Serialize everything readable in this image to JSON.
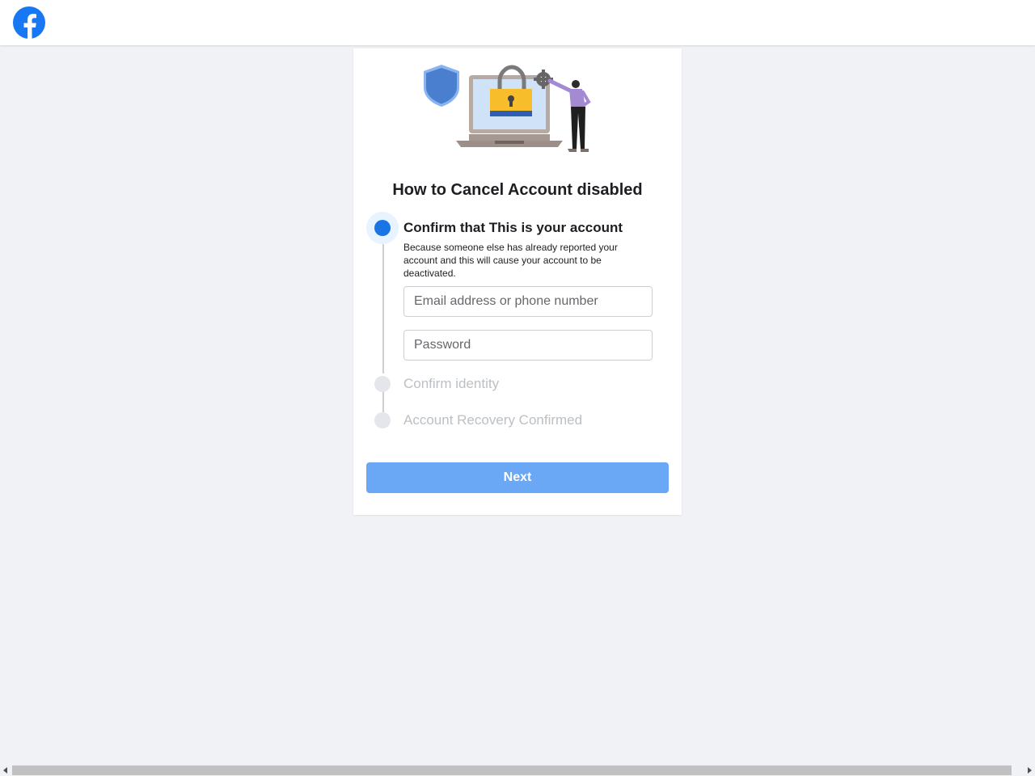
{
  "header": {
    "logo_icon": "facebook-logo-icon",
    "brand_color": "#1877f2"
  },
  "illustration": {
    "icons": [
      "shield-icon",
      "laptop-icon",
      "padlock-icon",
      "gear-icon",
      "person-icon"
    ]
  },
  "card": {
    "title": "How to Cancel Account disabled",
    "steps": [
      {
        "title": "Confirm that This is your account",
        "description": "Because someone else has already reported your account and this will cause your account to be deactivated.",
        "state": "active"
      },
      {
        "title": "Confirm identity",
        "state": "inactive"
      },
      {
        "title": "Account Recovery Confirmed",
        "state": "inactive"
      }
    ],
    "email_placeholder": "Email address or phone number",
    "password_placeholder": "Password",
    "next_label": "Next"
  },
  "colors": {
    "accent": "#1b74e4",
    "button_disabled": "#6aa7f4",
    "background": "#f0f2f5",
    "inactive_text": "#bcc0c4"
  }
}
